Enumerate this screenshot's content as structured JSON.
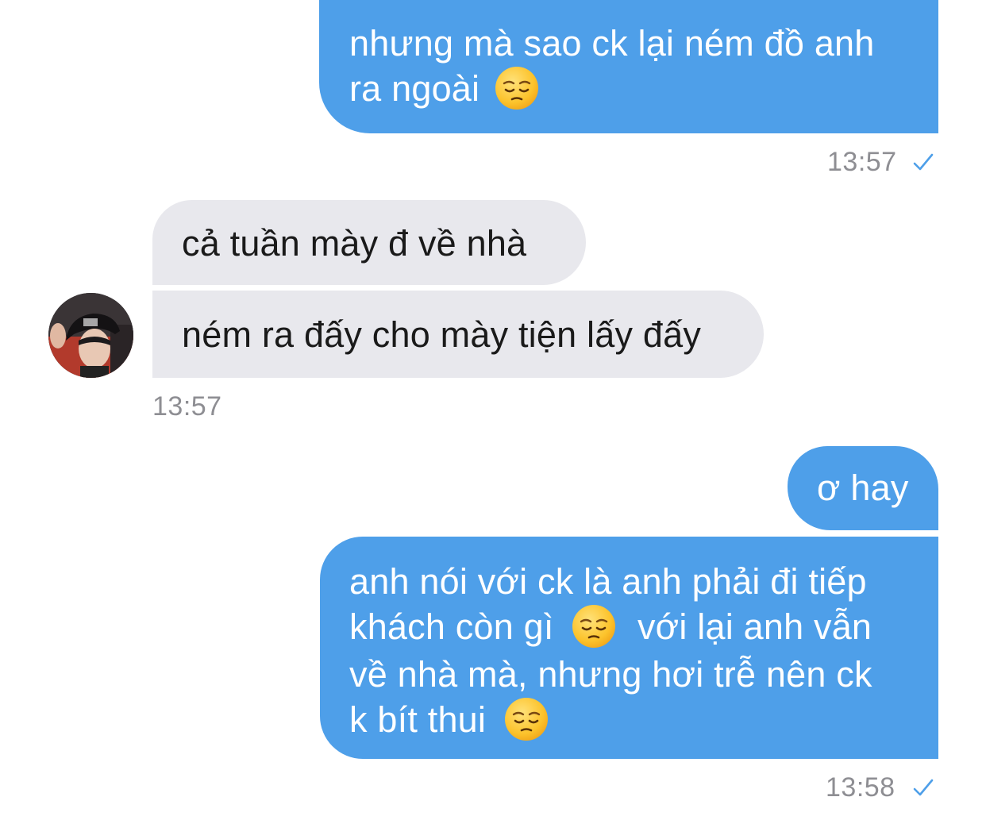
{
  "messages": [
    {
      "id": "m1",
      "sender": "me",
      "lines": [
        "nhưng mà sao ck lại ném đồ anh",
        "ra ngoài"
      ],
      "emoji": "pensive-face"
    },
    {
      "id": "m2",
      "sender": "other",
      "text": "cả tuần mày đ về nhà"
    },
    {
      "id": "m3",
      "sender": "other",
      "text": "ném ra đấy cho mày tiện lấy đấy"
    },
    {
      "id": "m4",
      "sender": "me",
      "text": "ơ hay"
    },
    {
      "id": "m5",
      "sender": "me",
      "line1": "anh nói với ck là anh phải đi tiếp",
      "line2a": "khách còn gì",
      "line2b": "với lại anh vẫn",
      "line3": "về nhà mà, nhưng hơi trễ nên ck",
      "line4": "k bít thui",
      "emoji": "pensive-face"
    }
  ],
  "timestamps": {
    "t1": "13:57",
    "t2": "13:57",
    "t3": "13:58"
  },
  "colors": {
    "outgoing_bubble": "#4e9fe9",
    "incoming_bubble": "#e8e8ed",
    "timestamp": "#8e8e93",
    "read_check": "#4e9fe9"
  },
  "icons": {
    "read_receipt": "check-icon",
    "emoji": "pensive-face-emoji"
  }
}
